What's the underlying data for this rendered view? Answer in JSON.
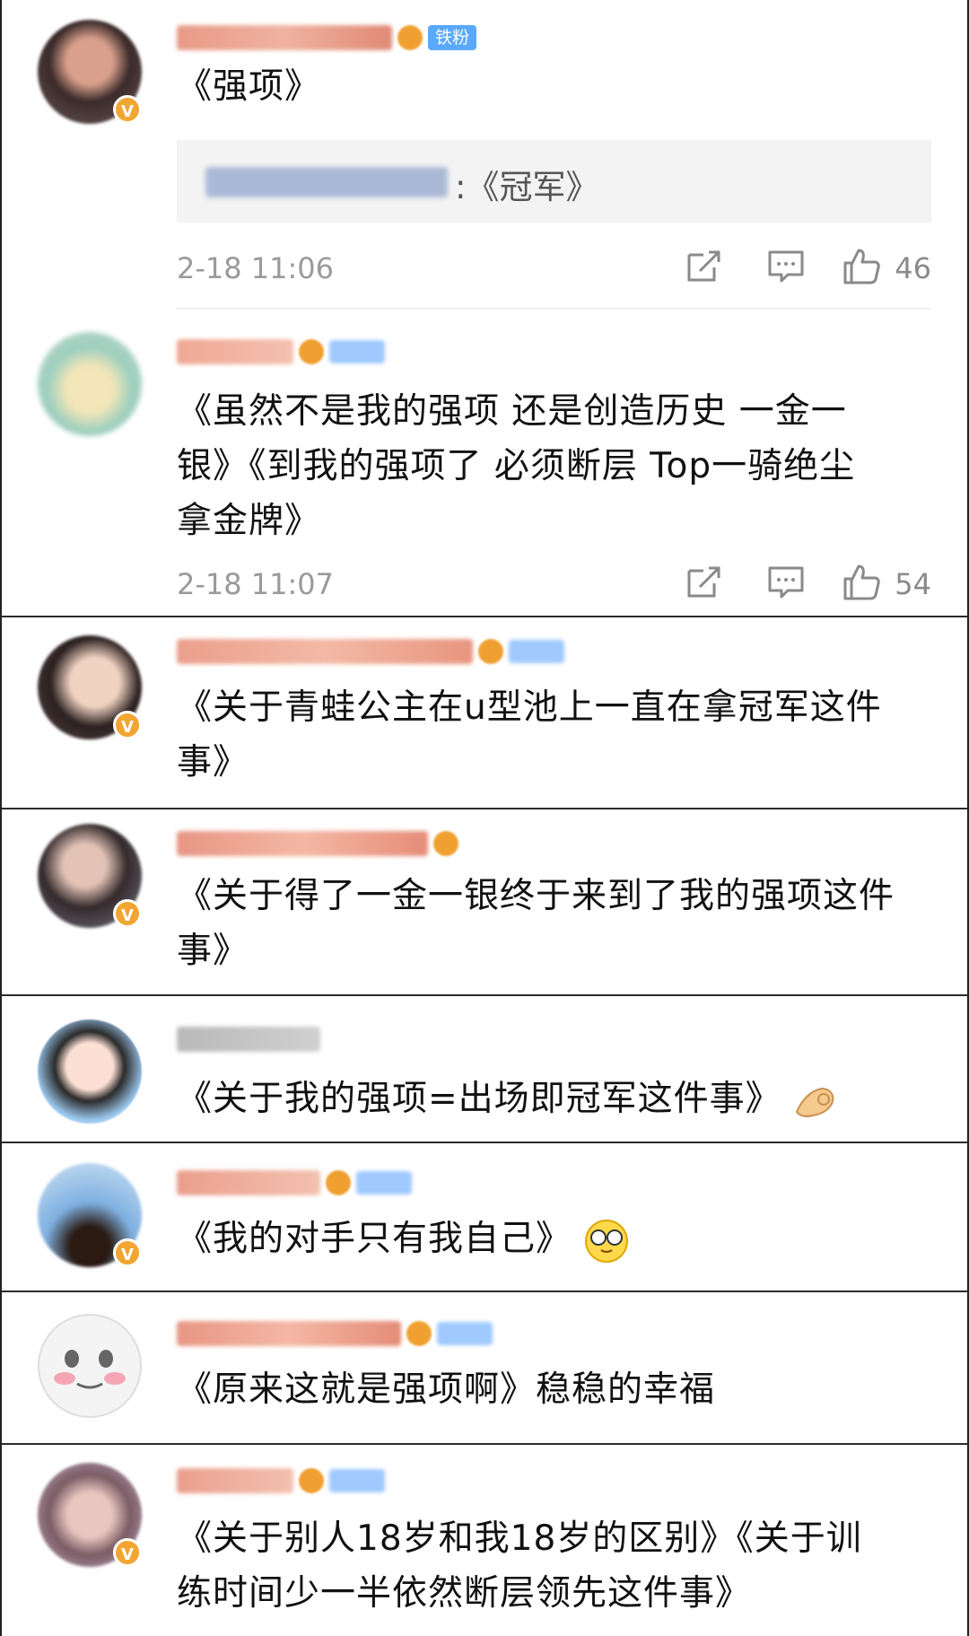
{
  "comments": [
    {
      "user": {
        "fan_badge": "铁粉"
      },
      "text": "《强项》",
      "reply": {
        "text": ":《冠军》"
      },
      "time": "2-18 11:06",
      "likes": "46"
    },
    {
      "text_line1": "《虽然不是我的强项 还是创造历史 一金一",
      "text_line2": "银》《到我的强项了 必须断层 Top一骑绝尘",
      "text_line3": "拿金牌》",
      "time": "2-18 11:07",
      "likes": "54"
    },
    {
      "text_line1": "《关于青蛙公主在u型池上一直在拿冠军这件",
      "text_line2": "事》"
    },
    {
      "text_line1": "《关于得了一金一银终于来到了我的强项这件",
      "text_line2": "事》"
    },
    {
      "text": "《关于我的强项=出场即冠军这件事》",
      "emoji": "ok-hand-emoji"
    },
    {
      "text": "《我的对手只有我自己》",
      "emoji": "glasses-face-emoji"
    },
    {
      "text": "《原来这就是强项啊》稳稳的幸福"
    },
    {
      "text_line1": "《关于别人18岁和我18岁的区别》《关于训",
      "text_line2": "练时间少一半依然断层领先这件事》"
    }
  ],
  "icons": {
    "repost": "share-icon",
    "comment": "comment-icon",
    "like": "thumbs-up-icon",
    "verified": "verified-v-icon"
  },
  "verified_mark": "V",
  "colors": {
    "badge_orange": "#f2a531",
    "fan_blue": "#5aa8ff",
    "meta_gray": "#9a9a9a"
  }
}
